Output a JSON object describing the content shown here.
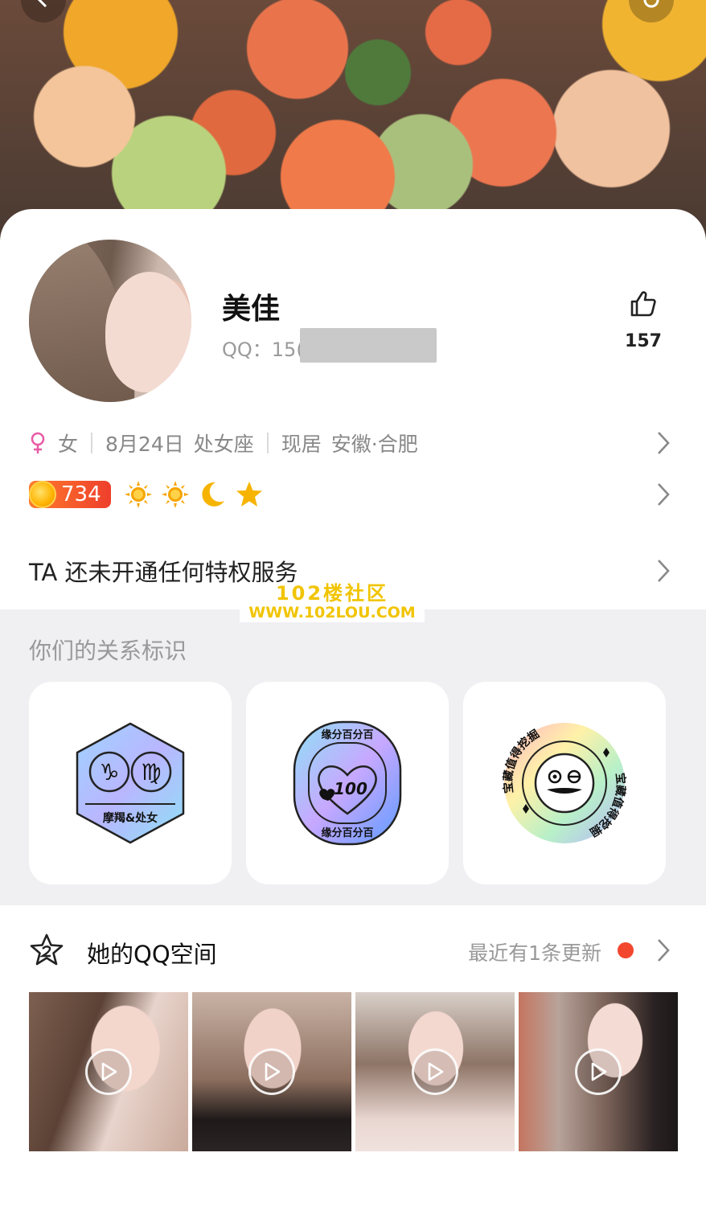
{
  "profile": {
    "name": "美佳",
    "qq_prefix": "QQ：15(",
    "like_count": "157"
  },
  "info": {
    "gender": "女",
    "birthday": "8月24日",
    "zodiac": "处女座",
    "location_label": "现居",
    "location": "安徽·合肥"
  },
  "level": {
    "value": "734",
    "icons": [
      "sun-icon",
      "sun-icon",
      "moon-icon",
      "star-icon"
    ]
  },
  "privilege": {
    "text": "TA 还未开通任何特权服务"
  },
  "watermark": {
    "line1": "102楼社区",
    "line2": "WWW.102LOU.COM"
  },
  "relationship": {
    "title": "你们的关系标识",
    "badges": [
      {
        "label": "摩羯&处女",
        "icon": "zodiac-badge-icon"
      },
      {
        "label_top": "缘分百分百",
        "label_bottom": "缘分百分百",
        "center": "100",
        "icon": "heart-badge-icon"
      },
      {
        "label": "宝藏值得挖掘",
        "icon": "treasure-badge-icon"
      }
    ]
  },
  "space": {
    "title": "她的QQ空间",
    "update_text": "最近有1条更新"
  },
  "colors": {
    "accent_red": "#f2472e",
    "level_orange": "#ff7b2a",
    "female_pink": "#e85aa5",
    "watermark_yellow": "#f1c400"
  }
}
